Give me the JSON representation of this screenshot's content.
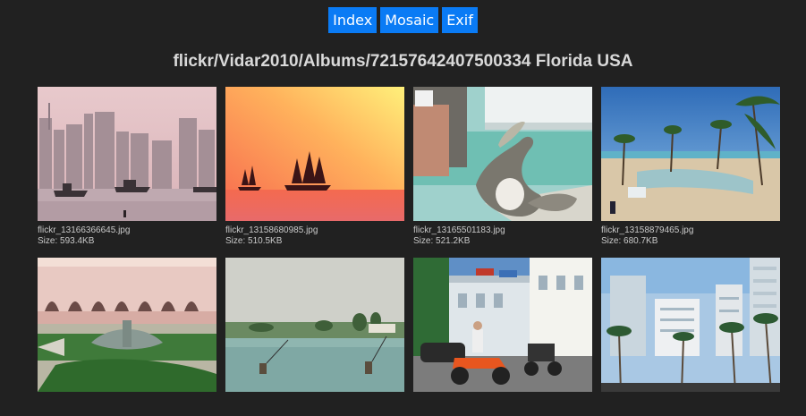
{
  "nav": {
    "index_label": "Index",
    "mosaic_label": "Mosaic",
    "exif_label": "Exif"
  },
  "page_title": "flickr/Vidar2010/Albums/72157642407500334 Florida USA",
  "size_prefix": "Size: ",
  "photos": [
    {
      "filename": "flickr_13166366645.jpg",
      "size": "593.4KB"
    },
    {
      "filename": "flickr_13158680985.jpg",
      "size": "510.5KB"
    },
    {
      "filename": "flickr_13165501183.jpg",
      "size": "521.2KB"
    },
    {
      "filename": "flickr_13158879465.jpg",
      "size": "680.7KB"
    },
    {
      "filename": "",
      "size": ""
    },
    {
      "filename": "",
      "size": ""
    },
    {
      "filename": "",
      "size": ""
    },
    {
      "filename": "",
      "size": ""
    }
  ],
  "colors": {
    "background": "#212121",
    "button": "#0a7bf5",
    "title": "#d9d9d9",
    "caption": "#c9c9c9"
  }
}
